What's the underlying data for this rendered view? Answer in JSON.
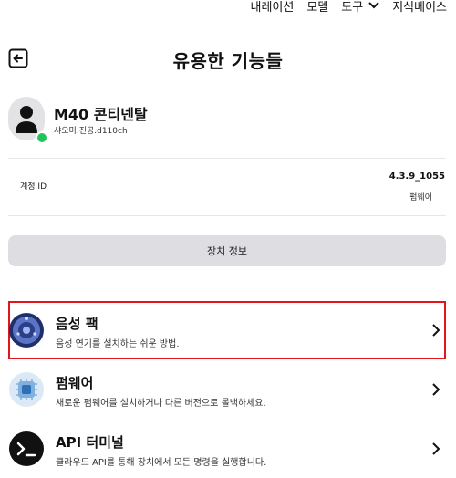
{
  "topnav": {
    "item1": "내레이션",
    "item2": "모델",
    "tools": "도구",
    "item4": "지식베이스"
  },
  "header": {
    "title": "유용한 기능들"
  },
  "device": {
    "name": "M40 콘티넨탈",
    "subtitle": "샤오미.진공.d110ch",
    "status_color": "#23c35a"
  },
  "account": {
    "label": "계정 ID",
    "value": "4.3.9_1055",
    "sub": "펌웨어"
  },
  "device_info_button": "장치 정보",
  "features": [
    {
      "title": "음성 팩",
      "subtitle": "음성 연기를 설치하는 쉬운 방법.",
      "icon": "voice-pack-icon",
      "selected": true
    },
    {
      "title": "펌웨어",
      "subtitle": "새로운 펌웨어를 설치하거나 다른 버전으로 롤백하세요.",
      "icon": "firmware-chip-icon",
      "selected": false
    },
    {
      "title": "API 터미널",
      "subtitle": "클라우드 API를 통해 장치에서 모든 명령을 실행합니다.",
      "icon": "terminal-icon",
      "selected": false
    }
  ],
  "colors": {
    "selection_border": "#e3141c",
    "button_bg": "#dedee2"
  }
}
